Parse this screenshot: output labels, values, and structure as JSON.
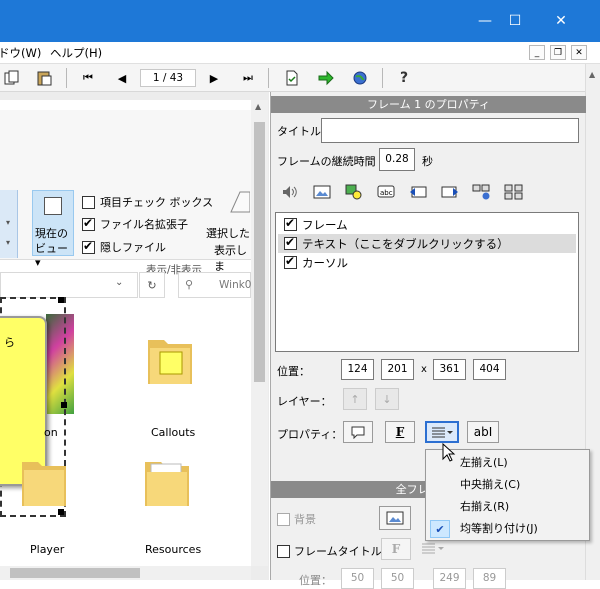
{
  "menu": {
    "window": "ドウ(W)",
    "help": "ヘルプ(H)"
  },
  "toolbar": {
    "page_indicator": "1 / 43"
  },
  "explorer": {
    "ribbon": {
      "current_view": "現在の",
      "current_view_2": "ビュー▾",
      "item_checkbox": "項目チェック ボックス",
      "file_ext": "ファイル名拡張子",
      "hidden_files": "隠しファイル",
      "selected_1": "選択した",
      "selected_2": "表示しま",
      "group_label": "表示/非表示"
    },
    "search_placeholder": "Wink0",
    "folders": [
      "Callouts",
      "Player",
      "Resources"
    ],
    "cropped_label": "on",
    "callout_text": "ら"
  },
  "panel": {
    "header": "フレーム 1 のプロパティ",
    "title_label": "タイトル",
    "title_value": "",
    "duration_label": "フレームの継続時間",
    "duration_value": "0.28",
    "duration_unit": "秒",
    "layers": [
      {
        "label": "フレーム",
        "checked": true
      },
      {
        "label": "テキスト（ここをダブルクリックする）",
        "checked": true
      },
      {
        "label": "カーソル",
        "checked": true
      }
    ],
    "position_label": "位置：",
    "position": [
      "124",
      "201",
      "361",
      "404"
    ],
    "x_sep": "x",
    "layer_label": "レイヤー：",
    "props_label": "プロパティ：",
    "all_frames_header": "全フレームに",
    "background_label": "背景",
    "frame_title_label": "フレームタイトル",
    "bottom_position_label": "位置：",
    "bottom_position": [
      "50",
      "50",
      "249",
      "89"
    ]
  },
  "dropdown": {
    "items": [
      {
        "label": "左揃え(L)",
        "checked": false
      },
      {
        "label": "中央揃え(C)",
        "checked": false
      },
      {
        "label": "右揃え(R)",
        "checked": false
      },
      {
        "label": "均等割り付け(J)",
        "checked": true
      }
    ]
  },
  "colors": {
    "titlebar": "#1e78d7",
    "panel_header": "#8a8a8a",
    "selection": "#cde8ff"
  }
}
